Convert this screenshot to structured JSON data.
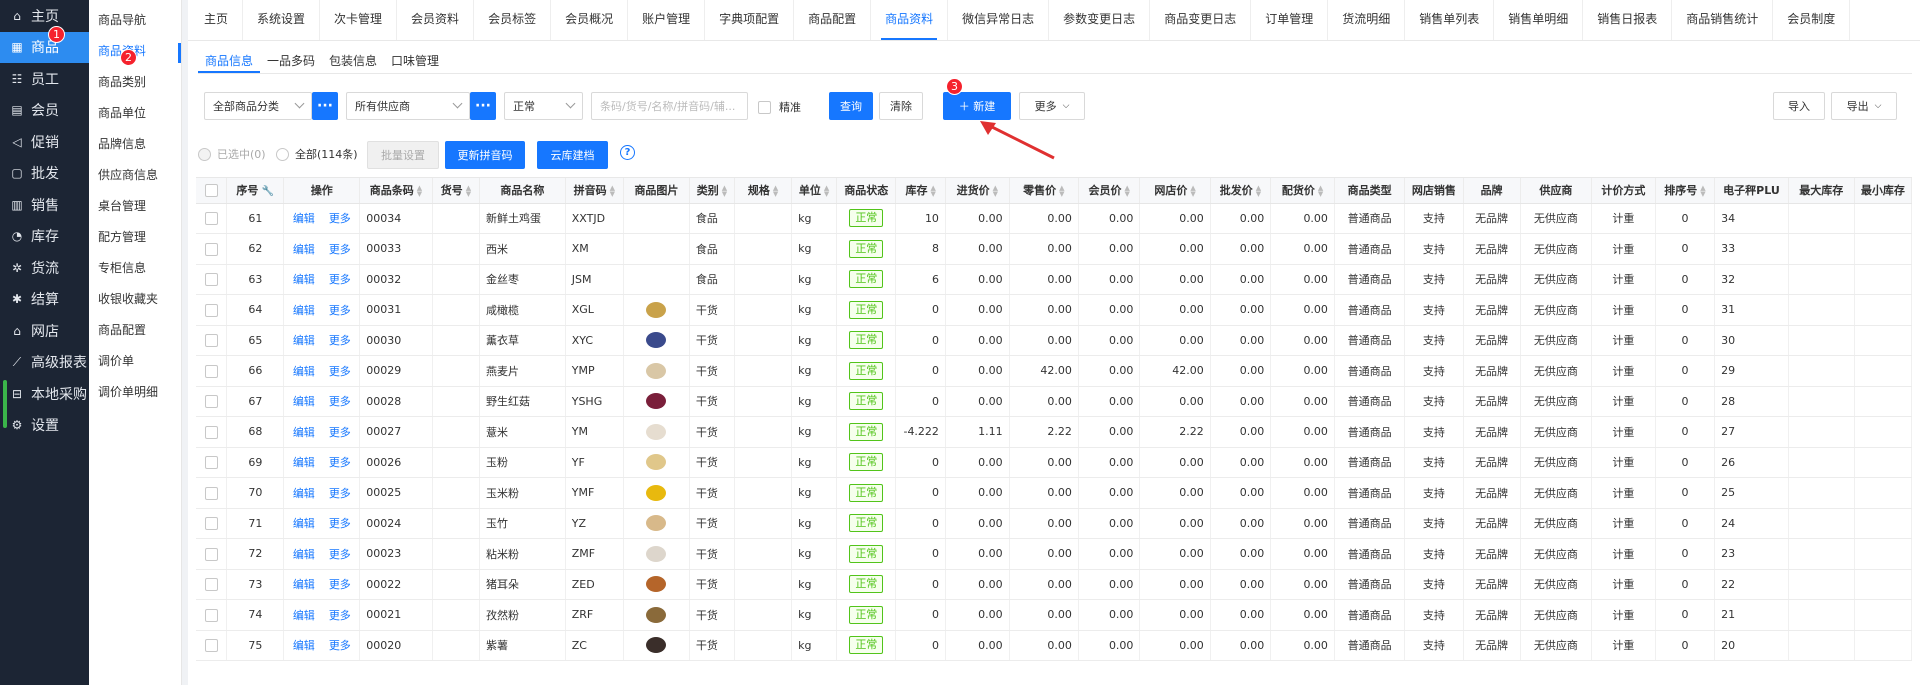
{
  "nav": [
    {
      "label": "主页",
      "icon": "home-icon",
      "glyph": "⌂"
    },
    {
      "label": "商品",
      "icon": "grid-icon",
      "glyph": "▦",
      "active": true,
      "badge": "1"
    },
    {
      "label": "员工",
      "icon": "person-icon",
      "glyph": "☷"
    },
    {
      "label": "会员",
      "icon": "member-card-icon",
      "glyph": "▤"
    },
    {
      "label": "促销",
      "icon": "megaphone-icon",
      "glyph": "◁"
    },
    {
      "label": "批发",
      "icon": "document-icon",
      "glyph": "▢"
    },
    {
      "label": "销售",
      "icon": "bar-chart-icon",
      "glyph": "▥"
    },
    {
      "label": "库存",
      "icon": "dashboard-icon",
      "glyph": "◔"
    },
    {
      "label": "货流",
      "icon": "gear-flow-icon",
      "glyph": "✲"
    },
    {
      "label": "结算",
      "icon": "settle-icon",
      "glyph": "✱"
    },
    {
      "label": "网店",
      "icon": "store-icon",
      "glyph": "⌂"
    },
    {
      "label": "高级报表",
      "icon": "line-chart-icon",
      "glyph": "⟋"
    },
    {
      "label": "本地采购",
      "icon": "cart-icon",
      "glyph": "⊟"
    },
    {
      "label": "设置",
      "icon": "settings-icon",
      "glyph": "⚙"
    }
  ],
  "subnav": [
    {
      "label": "商品导航"
    },
    {
      "label": "商品资料",
      "active": true,
      "badge": "2"
    },
    {
      "label": "商品类别"
    },
    {
      "label": "商品单位"
    },
    {
      "label": "品牌信息"
    },
    {
      "label": "供应商信息"
    },
    {
      "label": "桌台管理"
    },
    {
      "label": "配方管理"
    },
    {
      "label": "专柜信息"
    },
    {
      "label": "收银收藏夹"
    },
    {
      "label": "商品配置"
    },
    {
      "label": "调价单"
    },
    {
      "label": "调价单明细"
    }
  ],
  "top_tabs": [
    "主页",
    "系统设置",
    "次卡管理",
    "会员资料",
    "会员标签",
    "会员概况",
    "账户管理",
    "字典项配置",
    "商品配置",
    "商品资料",
    "微信异常日志",
    "参数变更日志",
    "商品变更日志",
    "订单管理",
    "货流明细",
    "销售单列表",
    "销售单明细",
    "销售日报表",
    "商品销售统计",
    "会员制度"
  ],
  "active_top_tab": "商品资料",
  "sub_tabs": [
    "商品信息",
    "一品多码",
    "包装信息",
    "口味管理"
  ],
  "filters": {
    "category": "全部商品分类",
    "supplier": "所有供应商",
    "status": "正常",
    "search_placeholder": "条码/货号/名称/拼音码/辅...",
    "precise_label": "精准"
  },
  "buttons": {
    "query": "查询",
    "clear": "清除",
    "new": "＋ 新建",
    "new_badge": "3",
    "more": "更多",
    "import": "导入",
    "export": "导出",
    "batch": "批量设置",
    "update_pinyin": "更新拼音码",
    "cloud": "云库建档"
  },
  "selection": {
    "selected": "已选中(0)",
    "all": "全部(114条)"
  },
  "columns": [
    "序号",
    "操作",
    "商品条码",
    "货号",
    "商品名称",
    "拼音码",
    "商品图片",
    "类别",
    "规格",
    "单位",
    "商品状态",
    "库存",
    "进货价",
    "零售价",
    "会员价",
    "网店价",
    "批发价",
    "配货价",
    "商品类型",
    "网店销售",
    "品牌",
    "供应商",
    "计价方式",
    "排序号",
    "电子秤PLU",
    "最大库存",
    "最小库存"
  ],
  "row_labels": {
    "edit": "编辑",
    "more": "更多"
  },
  "rows": [
    {
      "no": "61",
      "code": "00034",
      "name": "新鲜土鸡蛋",
      "py": "XXTJD",
      "img": "",
      "cat": "食品",
      "unit": "kg",
      "status": "正常",
      "stock": "10",
      "buy": "0.00",
      "retail": "0.00",
      "member": "0.00",
      "web": "0.00",
      "whole": "0.00",
      "dist": "0.00",
      "type": "普通商品",
      "websell": "支持",
      "brand": "无品牌",
      "supplier": "无供应商",
      "pricing": "计重",
      "sort": "0",
      "plu": "34"
    },
    {
      "no": "62",
      "code": "00033",
      "name": "西米",
      "py": "XM",
      "img": "",
      "cat": "食品",
      "unit": "kg",
      "status": "正常",
      "stock": "8",
      "buy": "0.00",
      "retail": "0.00",
      "member": "0.00",
      "web": "0.00",
      "whole": "0.00",
      "dist": "0.00",
      "type": "普通商品",
      "websell": "支持",
      "brand": "无品牌",
      "supplier": "无供应商",
      "pricing": "计重",
      "sort": "0",
      "plu": "33"
    },
    {
      "no": "63",
      "code": "00032",
      "name": "金丝枣",
      "py": "JSM",
      "img": "",
      "cat": "食品",
      "unit": "kg",
      "status": "正常",
      "stock": "6",
      "buy": "0.00",
      "retail": "0.00",
      "member": "0.00",
      "web": "0.00",
      "whole": "0.00",
      "dist": "0.00",
      "type": "普通商品",
      "websell": "支持",
      "brand": "无品牌",
      "supplier": "无供应商",
      "pricing": "计重",
      "sort": "0",
      "plu": "32"
    },
    {
      "no": "64",
      "code": "00031",
      "name": "咸橄榄",
      "py": "XGL",
      "img": "#c9a24a",
      "cat": "干货",
      "unit": "kg",
      "status": "正常",
      "stock": "0",
      "buy": "0.00",
      "retail": "0.00",
      "member": "0.00",
      "web": "0.00",
      "whole": "0.00",
      "dist": "0.00",
      "type": "普通商品",
      "websell": "支持",
      "brand": "无品牌",
      "supplier": "无供应商",
      "pricing": "计重",
      "sort": "0",
      "plu": "31"
    },
    {
      "no": "65",
      "code": "00030",
      "name": "薰衣草",
      "py": "XYC",
      "img": "#3a4a8c",
      "cat": "干货",
      "unit": "kg",
      "status": "正常",
      "stock": "0",
      "buy": "0.00",
      "retail": "0.00",
      "member": "0.00",
      "web": "0.00",
      "whole": "0.00",
      "dist": "0.00",
      "type": "普通商品",
      "websell": "支持",
      "brand": "无品牌",
      "supplier": "无供应商",
      "pricing": "计重",
      "sort": "0",
      "plu": "30"
    },
    {
      "no": "66",
      "code": "00029",
      "name": "燕麦片",
      "py": "YMP",
      "img": "#d9c7a6",
      "cat": "干货",
      "unit": "kg",
      "status": "正常",
      "stock": "0",
      "buy": "0.00",
      "retail": "42.00",
      "member": "0.00",
      "web": "42.00",
      "whole": "0.00",
      "dist": "0.00",
      "type": "普通商品",
      "websell": "支持",
      "brand": "无品牌",
      "supplier": "无供应商",
      "pricing": "计重",
      "sort": "0",
      "plu": "29"
    },
    {
      "no": "67",
      "code": "00028",
      "name": "野生红菇",
      "py": "YSHG",
      "img": "#7a1f3a",
      "cat": "干货",
      "unit": "kg",
      "status": "正常",
      "stock": "0",
      "buy": "0.00",
      "retail": "0.00",
      "member": "0.00",
      "web": "0.00",
      "whole": "0.00",
      "dist": "0.00",
      "type": "普通商品",
      "websell": "支持",
      "brand": "无品牌",
      "supplier": "无供应商",
      "pricing": "计重",
      "sort": "0",
      "plu": "28"
    },
    {
      "no": "68",
      "code": "00027",
      "name": "薏米",
      "py": "YM",
      "img": "#e6ddd0",
      "cat": "干货",
      "unit": "kg",
      "status": "正常",
      "stock": "-4.222",
      "buy": "1.11",
      "retail": "2.22",
      "member": "0.00",
      "web": "2.22",
      "whole": "0.00",
      "dist": "0.00",
      "type": "普通商品",
      "websell": "支持",
      "brand": "无品牌",
      "supplier": "无供应商",
      "pricing": "计重",
      "sort": "0",
      "plu": "27"
    },
    {
      "no": "69",
      "code": "00026",
      "name": "玉粉",
      "py": "YF",
      "img": "#e0c78a",
      "cat": "干货",
      "unit": "kg",
      "status": "正常",
      "stock": "0",
      "buy": "0.00",
      "retail": "0.00",
      "member": "0.00",
      "web": "0.00",
      "whole": "0.00",
      "dist": "0.00",
      "type": "普通商品",
      "websell": "支持",
      "brand": "无品牌",
      "supplier": "无供应商",
      "pricing": "计重",
      "sort": "0",
      "plu": "26"
    },
    {
      "no": "70",
      "code": "00025",
      "name": "玉米粉",
      "py": "YMF",
      "img": "#e8b90e",
      "cat": "干货",
      "unit": "kg",
      "status": "正常",
      "stock": "0",
      "buy": "0.00",
      "retail": "0.00",
      "member": "0.00",
      "web": "0.00",
      "whole": "0.00",
      "dist": "0.00",
      "type": "普通商品",
      "websell": "支持",
      "brand": "无品牌",
      "supplier": "无供应商",
      "pricing": "计重",
      "sort": "0",
      "plu": "25"
    },
    {
      "no": "71",
      "code": "00024",
      "name": "玉竹",
      "py": "YZ",
      "img": "#d8b98a",
      "cat": "干货",
      "unit": "kg",
      "status": "正常",
      "stock": "0",
      "buy": "0.00",
      "retail": "0.00",
      "member": "0.00",
      "web": "0.00",
      "whole": "0.00",
      "dist": "0.00",
      "type": "普通商品",
      "websell": "支持",
      "brand": "无品牌",
      "supplier": "无供应商",
      "pricing": "计重",
      "sort": "0",
      "plu": "24"
    },
    {
      "no": "72",
      "code": "00023",
      "name": "粘米粉",
      "py": "ZMF",
      "img": "#ddd6cc",
      "cat": "干货",
      "unit": "kg",
      "status": "正常",
      "stock": "0",
      "buy": "0.00",
      "retail": "0.00",
      "member": "0.00",
      "web": "0.00",
      "whole": "0.00",
      "dist": "0.00",
      "type": "普通商品",
      "websell": "支持",
      "brand": "无品牌",
      "supplier": "无供应商",
      "pricing": "计重",
      "sort": "0",
      "plu": "23"
    },
    {
      "no": "73",
      "code": "00022",
      "name": "猪耳朵",
      "py": "ZED",
      "img": "#b5652a",
      "cat": "干货",
      "unit": "kg",
      "status": "正常",
      "stock": "0",
      "buy": "0.00",
      "retail": "0.00",
      "member": "0.00",
      "web": "0.00",
      "whole": "0.00",
      "dist": "0.00",
      "type": "普通商品",
      "websell": "支持",
      "brand": "无品牌",
      "supplier": "无供应商",
      "pricing": "计重",
      "sort": "0",
      "plu": "22"
    },
    {
      "no": "74",
      "code": "00021",
      "name": "孜然粉",
      "py": "ZRF",
      "img": "#8a6a3a",
      "cat": "干货",
      "unit": "kg",
      "status": "正常",
      "stock": "0",
      "buy": "0.00",
      "retail": "0.00",
      "member": "0.00",
      "web": "0.00",
      "whole": "0.00",
      "dist": "0.00",
      "type": "普通商品",
      "websell": "支持",
      "brand": "无品牌",
      "supplier": "无供应商",
      "pricing": "计重",
      "sort": "0",
      "plu": "21"
    },
    {
      "no": "75",
      "code": "00020",
      "name": "紫薯",
      "py": "ZC",
      "img": "#3a2e2a",
      "cat": "干货",
      "unit": "kg",
      "status": "正常",
      "stock": "0",
      "buy": "0.00",
      "retail": "0.00",
      "member": "0.00",
      "web": "0.00",
      "whole": "0.00",
      "dist": "0.00",
      "type": "普通商品",
      "websell": "支持",
      "brand": "无品牌",
      "supplier": "无供应商",
      "pricing": "计重",
      "sort": "0",
      "plu": "20"
    }
  ]
}
